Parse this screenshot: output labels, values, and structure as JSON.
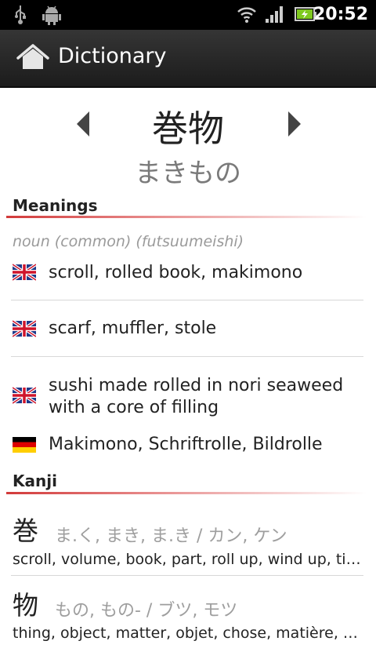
{
  "status_bar": {
    "time": "20:52",
    "icons": [
      "usb-icon",
      "android-debug-icon",
      "wifi-icon",
      "signal-icon",
      "battery-icon"
    ]
  },
  "action_bar": {
    "title": "Dictionary",
    "home_icon": "home-icon"
  },
  "entry": {
    "headword": "巻物",
    "reading": "まきもの"
  },
  "meanings": {
    "title": "Meanings",
    "part_of_speech": "noun (common) (futsuumeishi)",
    "items": [
      {
        "flag": "uk-flag-icon",
        "lines": [
          "scroll, rolled book, makimono"
        ]
      },
      {
        "flag": "uk-flag-icon",
        "lines": [
          "scarf, muffler, stole"
        ]
      },
      {
        "flag": "uk-flag-icon",
        "lines": [
          "sushi made rolled in nori seaweed",
          "with a core of filling"
        ]
      },
      {
        "flag": "germany-flag-icon",
        "lines": [
          "Makimono, Schriftrolle, Bildrolle"
        ]
      }
    ]
  },
  "kanji": {
    "title": "Kanji",
    "items": [
      {
        "char": "巻",
        "readings": "ま.く, まき, ま.き / カン, ケン",
        "meaning": "scroll, volume, book, part, roll up, wind up, tie, ..."
      },
      {
        "char": "物",
        "readings": "もの, もの- / ブツ, モツ",
        "meaning": "thing, object, matter, objet, chose, matière, cos..."
      }
    ]
  },
  "colors": {
    "accent": "#d23a3a",
    "action_bar": "#2a2a2a"
  }
}
